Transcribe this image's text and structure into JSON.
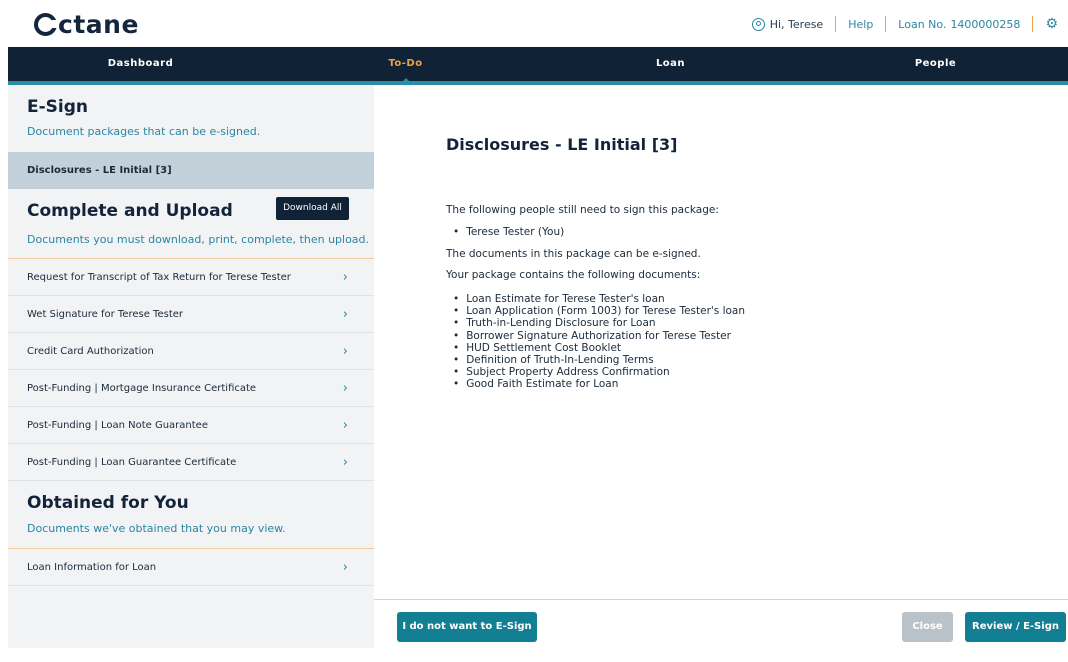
{
  "header": {
    "logo_text": "ctane",
    "greeting": "Hi, Terese",
    "help": "Help",
    "loan_label": "Loan No.",
    "loan_number": "1400000258"
  },
  "nav": {
    "items": [
      {
        "label": "Dashboard"
      },
      {
        "label": "To-Do"
      },
      {
        "label": "Loan"
      },
      {
        "label": "People"
      }
    ]
  },
  "sidebar": {
    "esign": {
      "title": "E-Sign",
      "subtitle": "Document packages that can be e-signed.",
      "packages": [
        "Disclosures - LE Initial [3]"
      ]
    },
    "complete": {
      "title": "Complete and Upload",
      "download_all": "Download All",
      "subtitle": "Documents you must download, print, complete, then upload.",
      "items": [
        "Request for Transcript of Tax Return for Terese Tester",
        "Wet Signature for Terese Tester",
        "Credit Card Authorization",
        "Post-Funding | Mortgage Insurance Certificate",
        "Post-Funding | Loan Note Guarantee",
        "Post-Funding | Loan Guarantee Certificate"
      ]
    },
    "obtained": {
      "title": "Obtained for You",
      "subtitle": "Documents we've obtained that you may view.",
      "items": [
        "Loan Information for Loan"
      ]
    }
  },
  "main": {
    "title": "Disclosures - LE Initial [3]",
    "need_sign_text": "The following people still need to sign this package:",
    "signers": [
      "Terese Tester (You)"
    ],
    "esign_text": "The documents in this package can be e-signed.",
    "contains_text": "Your package contains the following documents:",
    "documents": [
      "Loan Estimate for Terese Tester's loan",
      "Loan Application (Form 1003) for Terese Tester's loan",
      "Truth-in-Lending Disclosure for Loan",
      "Borrower Signature Authorization for Terese Tester",
      "HUD Settlement Cost Booklet",
      "Definition of Truth-In-Lending Terms",
      "Subject Property Address Confirmation",
      "Good Faith Estimate for Loan"
    ]
  },
  "footer": {
    "decline": "I do not want to E-Sign",
    "close": "Close",
    "review": "Review / E-Sign"
  },
  "icons": {
    "user": "user-circle-icon",
    "settings": "gear-icon",
    "chevron": "chevron-right-icon"
  },
  "colors": {
    "navy": "#0f2236",
    "teal": "#137f93",
    "accent_orange": "#f0a04b",
    "link_blue": "#2a86a3"
  }
}
